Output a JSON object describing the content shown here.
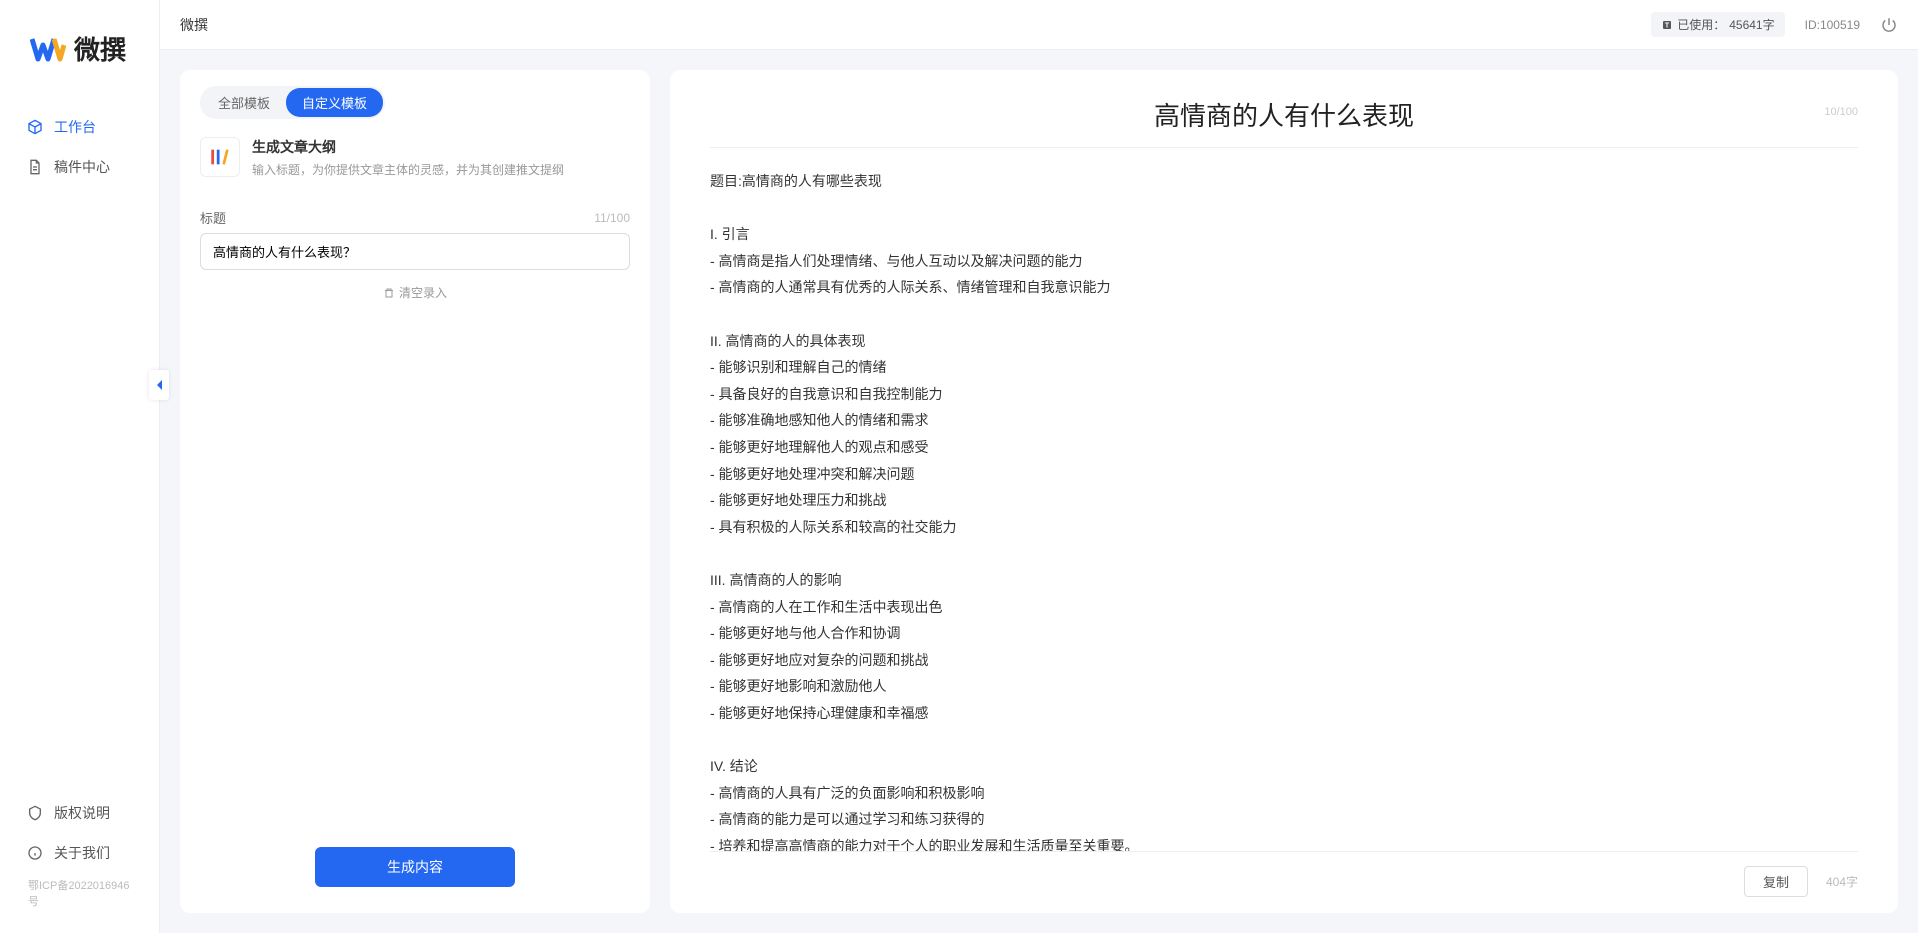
{
  "app": {
    "name": "微撰",
    "icp": "鄂ICP备2022016946号"
  },
  "header": {
    "title": "微撰",
    "usage_prefix": "已使用：",
    "usage_value": "45641字",
    "id_label": "ID:100519"
  },
  "sidebar": {
    "items": [
      {
        "label": "工作台",
        "icon": "cube",
        "active": true
      },
      {
        "label": "稿件中心",
        "icon": "document",
        "active": false
      }
    ],
    "footer": [
      {
        "label": "版权说明",
        "icon": "shield"
      },
      {
        "label": "关于我们",
        "icon": "info"
      }
    ]
  },
  "left": {
    "tabs": [
      {
        "label": "全部模板",
        "active": false
      },
      {
        "label": "自定义模板",
        "active": true
      }
    ],
    "template": {
      "title": "生成文章大纲",
      "desc": "输入标题，为你提供文章主体的灵感，并为其创建推文提纲"
    },
    "form": {
      "label": "标题",
      "count": "11/100",
      "value": "高情商的人有什么表现？",
      "clear": "清空录入"
    },
    "button": "生成内容"
  },
  "right": {
    "title": "高情商的人有什么表现",
    "count_meta": "10/100",
    "body": "题目:高情商的人有哪些表现\n\nI. 引言\n- 高情商是指人们处理情绪、与他人互动以及解决问题的能力\n- 高情商的人通常具有优秀的人际关系、情绪管理和自我意识能力\n\nII. 高情商的人的具体表现\n- 能够识别和理解自己的情绪\n- 具备良好的自我意识和自我控制能力\n- 能够准确地感知他人的情绪和需求\n- 能够更好地理解他人的观点和感受\n- 能够更好地处理冲突和解决问题\n- 能够更好地处理压力和挑战\n- 具有积极的人际关系和较高的社交能力\n\nIII. 高情商的人的影响\n- 高情商的人在工作和生活中表现出色\n- 能够更好地与他人合作和协调\n- 能够更好地应对复杂的问题和挑战\n- 能够更好地影响和激励他人\n- 能够更好地保持心理健康和幸福感\n\nIV. 结论\n- 高情商的人具有广泛的负面影响和积极影响\n- 高情商的能力是可以通过学习和练习获得的\n- 培养和提高高情商的能力对于个人的职业发展和生活质量至关重要。",
    "copy": "复制",
    "wordcount": "404字"
  }
}
